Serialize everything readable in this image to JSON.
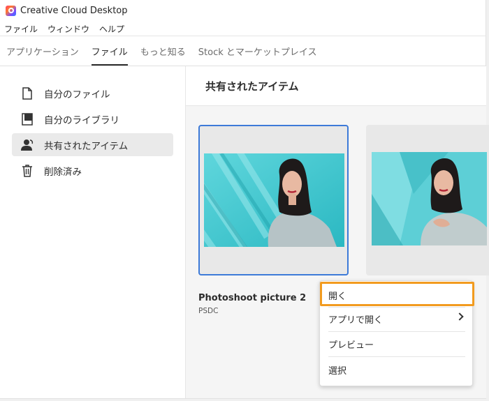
{
  "window": {
    "title": "Creative Cloud Desktop"
  },
  "menubar": [
    "ファイル",
    "ウィンドウ",
    "ヘルプ"
  ],
  "tabs": [
    {
      "label": "アプリケーション",
      "active": false
    },
    {
      "label": "ファイル",
      "active": true
    },
    {
      "label": "もっと知る",
      "active": false
    },
    {
      "label": "Stock とマーケットプレイス",
      "active": false
    }
  ],
  "sidebar": {
    "items": [
      {
        "label": "自分のファイル",
        "icon": "file-icon",
        "active": false
      },
      {
        "label": "自分のライブラリ",
        "icon": "library-icon",
        "active": false
      },
      {
        "label": "共有されたアイテム",
        "icon": "shared-user-icon",
        "active": true
      },
      {
        "label": "削除済み",
        "icon": "trash-icon",
        "active": false
      }
    ]
  },
  "main": {
    "header": "共有されたアイテム",
    "files": [
      {
        "name": "Photoshoot picture 2",
        "type": "PSDC",
        "selected": true
      },
      {
        "name": "",
        "type": "",
        "selected": false
      }
    ]
  },
  "context_menu": {
    "items": [
      {
        "label": "開く",
        "highlighted": true,
        "submenu": false
      },
      {
        "label": "アプリで開く",
        "highlighted": false,
        "submenu": true
      },
      {
        "label": "プレビュー",
        "highlighted": false,
        "submenu": false
      },
      {
        "label": "選択",
        "highlighted": false,
        "submenu": false
      }
    ]
  },
  "colors": {
    "selection_border": "#3d7ad8",
    "highlight_outline": "#f29b1f",
    "teal_background": "#3cc6cf"
  }
}
